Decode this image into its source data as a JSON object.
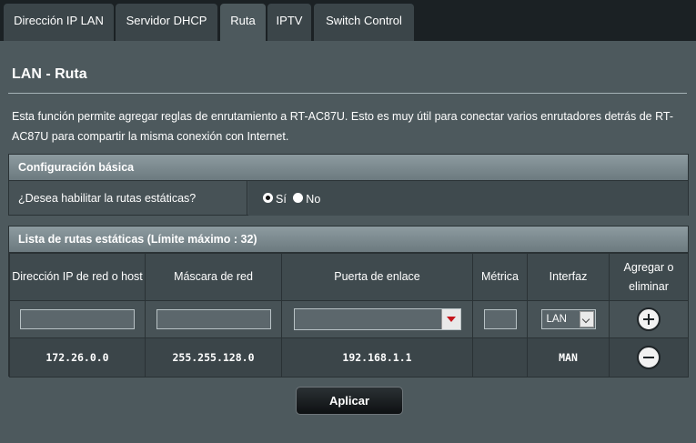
{
  "tabs": [
    {
      "label": "Dirección IP LAN"
    },
    {
      "label": "Servidor DHCP"
    },
    {
      "label": "Ruta"
    },
    {
      "label": "IPTV"
    },
    {
      "label": "Switch Control"
    }
  ],
  "active_tab": "Ruta",
  "page": {
    "title": "LAN - Ruta",
    "description": "Esta función permite agregar reglas de enrutamiento a RT-AC87U. Esto es muy útil para conectar varios enrutadores detrás de RT-AC87U para compartir la misma conexión con Internet."
  },
  "basic_config": {
    "header": "Configuración básica",
    "label": "¿Desea habilitar la rutas estáticas?",
    "options": [
      "Sí",
      "No"
    ],
    "selected": "Sí"
  },
  "routes": {
    "header": "Lista de rutas estáticas (Límite máximo : 32)",
    "columns": [
      "Dirección IP de red o host",
      "Máscara de red",
      "Puerta de enlace",
      "Métrica",
      "Interfaz",
      "Agregar o eliminar"
    ],
    "new_row": {
      "interface": "LAN"
    },
    "rows": [
      {
        "network": "172.26.0.0",
        "netmask": "255.255.128.0",
        "gateway": "192.168.1.1",
        "metric": "",
        "interface": "MAN"
      }
    ]
  },
  "apply_label": "Aplicar",
  "colors": {
    "background": "#4d595d",
    "tab": "#3b4549",
    "header_bar": "#8d9ba0",
    "dropdown_arrow": "#c5161d"
  }
}
